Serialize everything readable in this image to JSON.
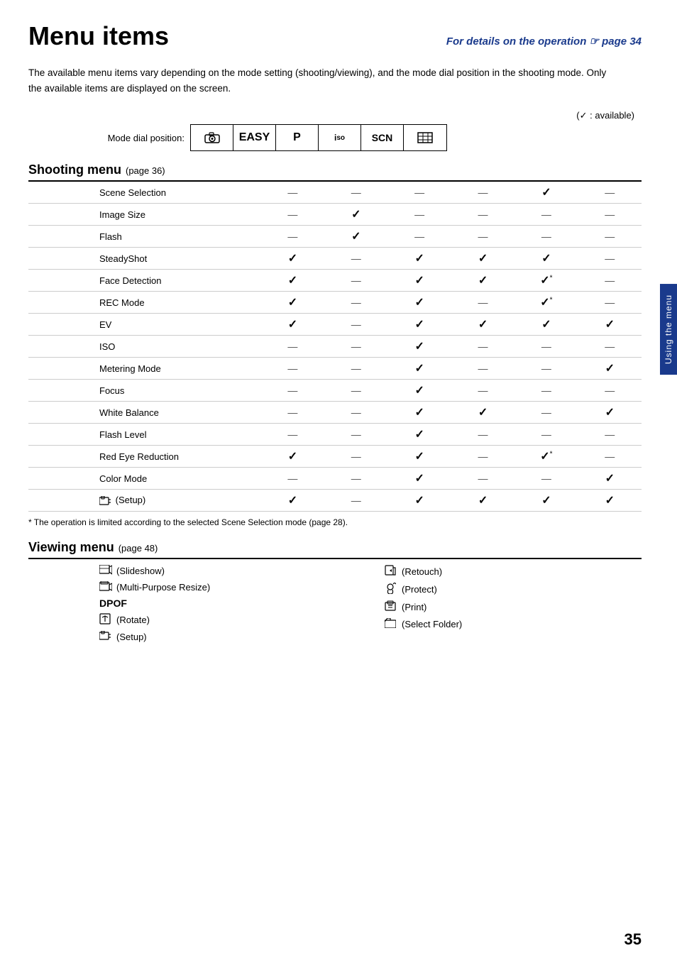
{
  "header": {
    "title": "Menu items",
    "reference": "For details on the operation ☞ page 34"
  },
  "intro": "The available menu items vary depending on the mode setting (shooting/viewing), and the mode dial position in the shooting mode. Only the available items are displayed on the screen.",
  "legend": "(✓ : available)",
  "mode_dial_label": "Mode dial position:",
  "modes": [
    "📷",
    "EASY",
    "P",
    "ISO",
    "SCN",
    "⊞"
  ],
  "shooting_menu": {
    "title": "Shooting menu",
    "page_ref": "(page 36)",
    "rows": [
      {
        "name": "Scene Selection",
        "modes": [
          "—",
          "—",
          "—",
          "—",
          "✓",
          "—"
        ]
      },
      {
        "name": "Image Size",
        "modes": [
          "—",
          "✓",
          "—",
          "—",
          "—",
          "—"
        ]
      },
      {
        "name": "Flash",
        "modes": [
          "—",
          "✓",
          "—",
          "—",
          "—",
          "—"
        ]
      },
      {
        "name": "SteadyShot",
        "modes": [
          "✓",
          "—",
          "✓",
          "✓",
          "✓",
          "—"
        ]
      },
      {
        "name": "Face Detection",
        "modes": [
          "✓",
          "—",
          "✓",
          "✓",
          "✓*",
          "—"
        ]
      },
      {
        "name": "REC Mode",
        "modes": [
          "✓",
          "—",
          "✓",
          "—",
          "✓*",
          "—"
        ]
      },
      {
        "name": "EV",
        "modes": [
          "✓",
          "—",
          "✓",
          "✓",
          "✓",
          "✓"
        ]
      },
      {
        "name": "ISO",
        "modes": [
          "—",
          "—",
          "✓",
          "—",
          "—",
          "—"
        ]
      },
      {
        "name": "Metering Mode",
        "modes": [
          "—",
          "—",
          "✓",
          "—",
          "—",
          "✓"
        ]
      },
      {
        "name": "Focus",
        "modes": [
          "—",
          "—",
          "✓",
          "—",
          "—",
          "—"
        ]
      },
      {
        "name": "White Balance",
        "modes": [
          "—",
          "—",
          "✓",
          "✓",
          "—",
          "✓"
        ]
      },
      {
        "name": "Flash Level",
        "modes": [
          "—",
          "—",
          "✓",
          "—",
          "—",
          "—"
        ]
      },
      {
        "name": "Red Eye Reduction",
        "modes": [
          "✓",
          "—",
          "✓",
          "—",
          "✓*",
          "—"
        ]
      },
      {
        "name": "Color Mode",
        "modes": [
          "—",
          "—",
          "✓",
          "—",
          "—",
          "✓"
        ]
      },
      {
        "name": "⚙ (Setup)",
        "modes": [
          "✓",
          "—",
          "✓",
          "✓",
          "✓",
          "✓"
        ]
      }
    ]
  },
  "footnote": "* The operation is limited according to the selected Scene Selection mode (page 28).",
  "viewing_menu": {
    "title": "Viewing menu",
    "page_ref": "(page 48)",
    "items_col1": [
      {
        "icon": "🖼",
        "label": "(Slideshow)"
      },
      {
        "icon": "🎞",
        "label": "(Multi-Purpose Resize)"
      },
      {
        "icon": "DPOF",
        "label": ""
      },
      {
        "icon": "🔄",
        "label": "(Rotate)"
      },
      {
        "icon": "⚙",
        "label": "(Setup)"
      }
    ],
    "items_col2": [
      {
        "icon": "✂",
        "label": "(Retouch)"
      },
      {
        "icon": "🔒",
        "label": "(Protect)"
      },
      {
        "icon": "🖨",
        "label": "(Print)"
      },
      {
        "icon": "📁",
        "label": "(Select Folder)"
      }
    ]
  },
  "page_number": "35",
  "sidebar_label": "Using the menu"
}
